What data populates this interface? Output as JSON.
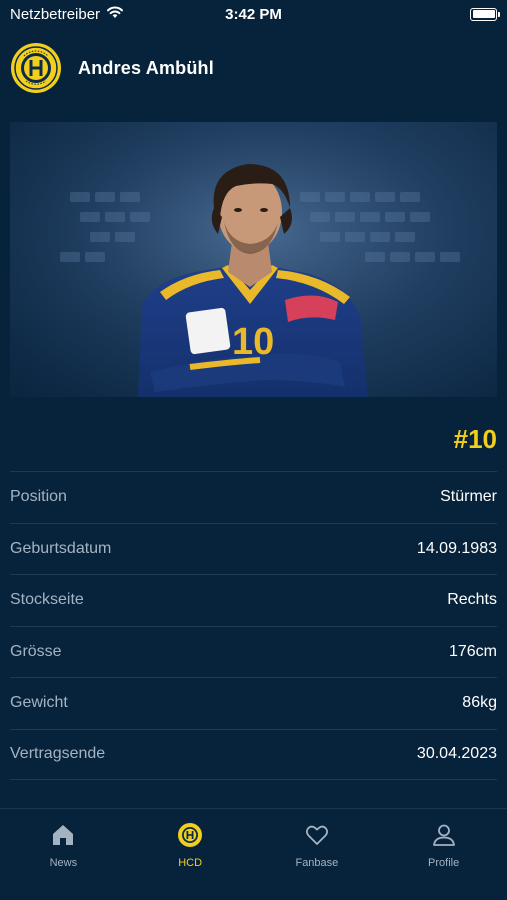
{
  "status_bar": {
    "carrier": "Netzbetreiber",
    "time": "3:42 PM",
    "wifi_icon": "wifi-icon",
    "battery_icon": "battery-icon"
  },
  "header": {
    "logo_icon": "hcd-club-logo",
    "player_name": "Andres Ambühl"
  },
  "hero": {
    "image": "player-portrait-photo",
    "jersey_print": "10"
  },
  "jersey_number": "#10",
  "details": [
    {
      "label": "Position",
      "value": "Stürmer"
    },
    {
      "label": "Geburtsdatum",
      "value": "14.09.1983"
    },
    {
      "label": "Stockseite",
      "value": "Rechts"
    },
    {
      "label": "Grösse",
      "value": "176cm"
    },
    {
      "label": "Gewicht",
      "value": "86kg"
    },
    {
      "label": "Vertragsende",
      "value": "30.04.2023"
    }
  ],
  "tabs": [
    {
      "label": "News",
      "icon": "home-icon",
      "active": false
    },
    {
      "label": "HCD",
      "icon": "hcd-logo-icon",
      "active": true
    },
    {
      "label": "Fanbase",
      "icon": "heart-icon",
      "active": false
    },
    {
      "label": "Profile",
      "icon": "person-icon",
      "active": false
    }
  ],
  "colors": {
    "background": "#07233b",
    "accent": "#f2cf1d",
    "label": "#a4b3c2",
    "divider": "#1c3a55"
  }
}
